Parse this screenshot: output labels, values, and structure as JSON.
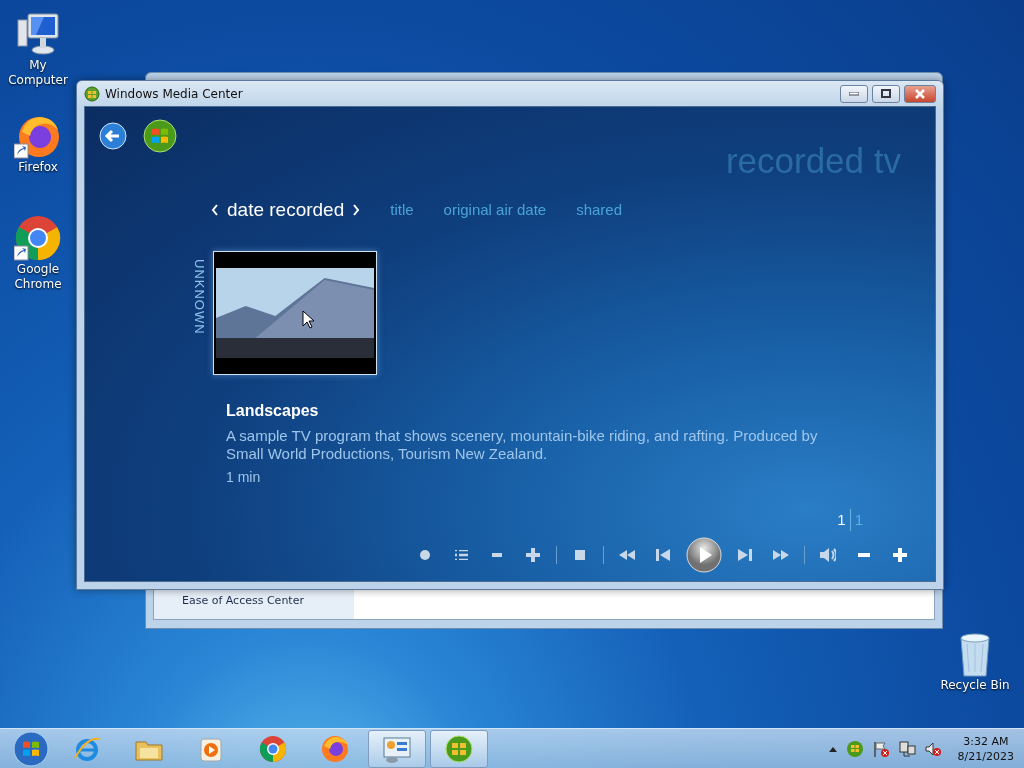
{
  "desktop_icons": [
    {
      "kind": "computer",
      "label": "My Computer",
      "shortcut": false
    },
    {
      "kind": "firefox",
      "label": "Firefox",
      "shortcut": true
    },
    {
      "kind": "chrome",
      "label": "Google Chrome",
      "shortcut": true
    }
  ],
  "recycle_bin": {
    "label": "Recycle Bin"
  },
  "background_window": {
    "sidebar_item": "Ease of Access Center"
  },
  "media_center": {
    "title": "Windows Media Center",
    "page_title": "recorded tv",
    "sort_tabs": [
      {
        "label": "date recorded",
        "selected": true
      },
      {
        "label": "title",
        "selected": false
      },
      {
        "label": "original air date",
        "selected": false
      },
      {
        "label": "shared",
        "selected": false
      }
    ],
    "group_label": "UNKNOWN",
    "item": {
      "title": "Landscapes",
      "description": "A sample TV program that shows scenery, mountain-bike riding, and rafting. Produced by Small World Productions, Tourism New Zealand.",
      "duration": "1 min"
    },
    "pager": {
      "current": "1",
      "total": "1"
    }
  },
  "taskbar": {
    "apps": [
      {
        "kind": "ie",
        "selected": false
      },
      {
        "kind": "explorer",
        "selected": false
      },
      {
        "kind": "player",
        "selected": false
      },
      {
        "kind": "chrome",
        "selected": false
      },
      {
        "kind": "firefox",
        "selected": false
      },
      {
        "kind": "control",
        "selected": true
      },
      {
        "kind": "mediacenter",
        "selected": true
      }
    ],
    "clock": {
      "time": "3:32 AM",
      "date": "8/21/2023"
    }
  }
}
